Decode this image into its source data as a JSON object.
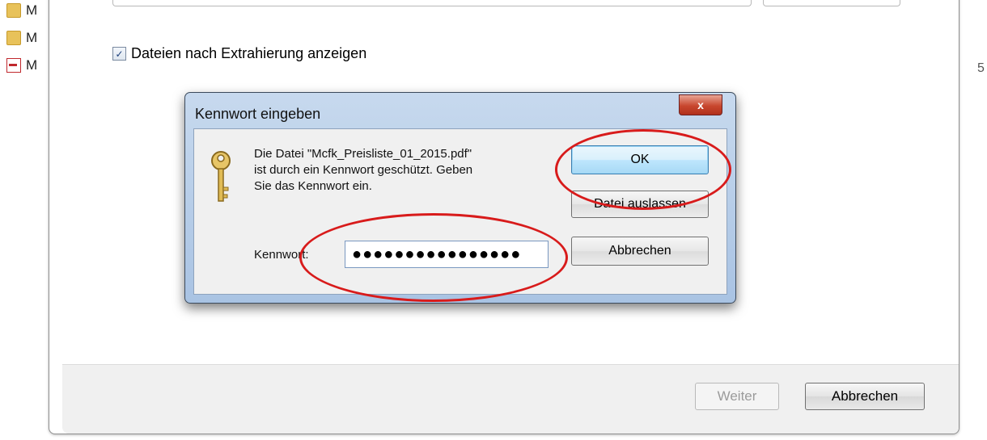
{
  "background": {
    "list_items": [
      {
        "label": "M",
        "icon": "folder-icon"
      },
      {
        "label": "M",
        "icon": "folder-icon"
      },
      {
        "label": "M",
        "icon": "pdf-file-icon"
      }
    ],
    "right_edge_text": "5"
  },
  "main_window": {
    "show_files_checkbox": {
      "label": "Dateien nach Extrahierung anzeigen",
      "checked": true
    },
    "next_button": "Weiter",
    "cancel_button": "Abbrechen"
  },
  "dialog": {
    "title": "Kennwort eingeben",
    "close_label": "x",
    "message_lines": [
      "Die Datei \"Mcfk_Preisliste_01_2015.pdf\"",
      "ist durch ein Kennwort geschützt. Geben",
      "Sie das Kennwort ein."
    ],
    "password_label": "Kennwort:",
    "password_value": "●●●●●●●●●●●●●●●●",
    "ok_button": "OK",
    "skip_button": "Datei auslassen",
    "cancel_button": "Abbrechen"
  },
  "colors": {
    "annotation": "#d81b1b",
    "title_bar": "#b7cde8",
    "close_button": "#c8472e"
  }
}
